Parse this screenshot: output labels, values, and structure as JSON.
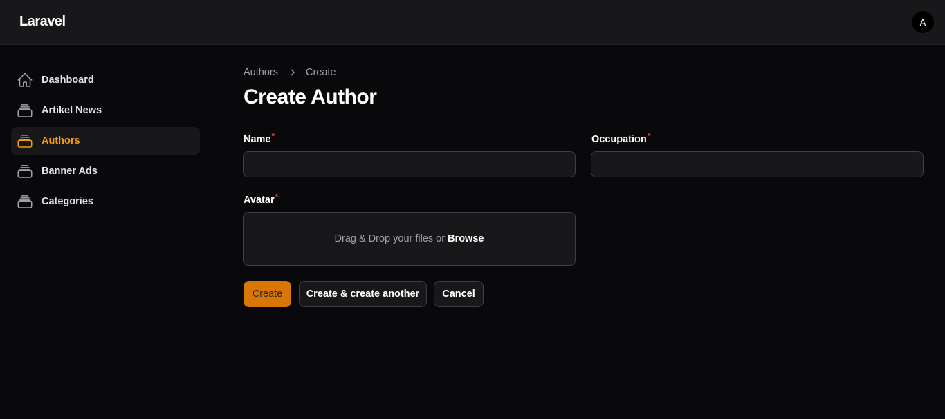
{
  "app": {
    "brand": "Laravel",
    "user_initial": "A"
  },
  "colors": {
    "accent": "#f59e0b",
    "primary_button": "#d97706",
    "required": "#ef4444"
  },
  "sidebar": {
    "items": [
      {
        "label": "Dashboard",
        "icon": "home-icon",
        "active": false
      },
      {
        "label": "Artikel News",
        "icon": "rectangle-stack-icon",
        "active": false
      },
      {
        "label": "Authors",
        "icon": "rectangle-stack-icon",
        "active": true
      },
      {
        "label": "Banner Ads",
        "icon": "rectangle-stack-icon",
        "active": false
      },
      {
        "label": "Categories",
        "icon": "rectangle-stack-icon",
        "active": false
      }
    ]
  },
  "breadcrumb": {
    "parent": "Authors",
    "current": "Create"
  },
  "page": {
    "title": "Create Author"
  },
  "form": {
    "name": {
      "label": "Name",
      "required_mark": "*",
      "value": ""
    },
    "occupation": {
      "label": "Occupation",
      "required_mark": "*",
      "value": ""
    },
    "avatar": {
      "label": "Avatar",
      "required_mark": "*",
      "dropzone_text": "Drag & Drop your files or",
      "browse_label": "Browse"
    }
  },
  "actions": {
    "create": "Create",
    "create_another": "Create & create another",
    "cancel": "Cancel"
  }
}
